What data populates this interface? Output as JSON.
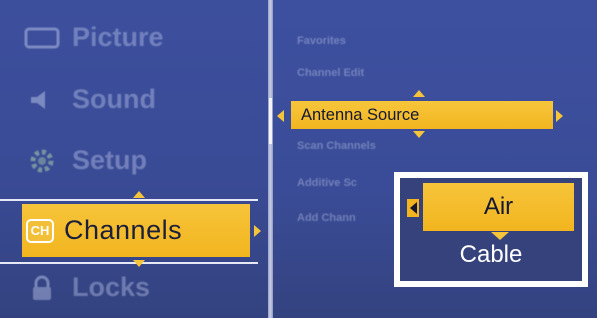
{
  "main_menu": {
    "items": [
      {
        "label": "Picture",
        "icon": "picture-icon"
      },
      {
        "label": "Sound",
        "icon": "speaker-icon"
      },
      {
        "label": "Setup",
        "icon": "gear-icon"
      },
      {
        "label": "Channels",
        "icon": "ch-icon",
        "badge": "CH",
        "selected": true
      },
      {
        "label": "Locks",
        "icon": "lock-icon"
      }
    ]
  },
  "channels_menu": {
    "items": [
      {
        "label": "Favorites"
      },
      {
        "label": "Channel Edit"
      },
      {
        "label": "Antenna Source",
        "selected": true
      },
      {
        "label": "Scan Channels"
      },
      {
        "label": "Additive Sc"
      },
      {
        "label": "Add Chann"
      }
    ]
  },
  "antenna_popup": {
    "options": [
      "Air",
      "Cable"
    ],
    "selected": "Air"
  },
  "colors": {
    "panel_blue": "#3a4b96",
    "highlight_yellow": "#f2b51f",
    "popup_bg": "#36427c",
    "text_dark": "#141833"
  }
}
